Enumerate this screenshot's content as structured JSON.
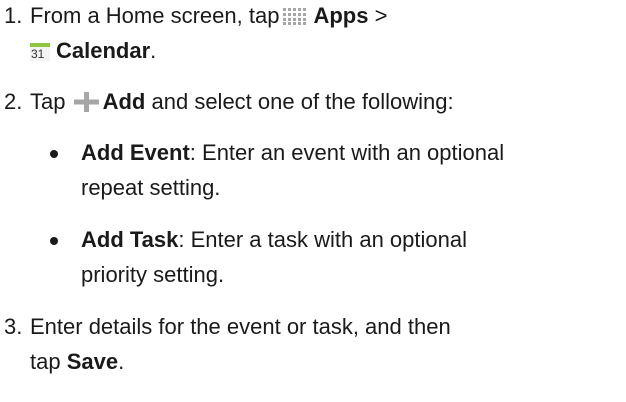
{
  "steps": [
    {
      "number": "1.",
      "line1_pre": "From a Home screen, tap",
      "line1_bold": "Apps",
      "line1_post": ">",
      "line2_bold": "Calendar",
      "line2_post": ".",
      "calendar_icon_text": "31"
    },
    {
      "number": "2.",
      "pre": "Tap",
      "bold": "Add",
      "post": "and select one of the following:",
      "options": [
        {
          "bold": "Add Event",
          "line1": ": Enter an event with an optional",
          "line2": "repeat setting."
        },
        {
          "bold": "Add Task",
          "line1": ": Enter a task with an optional",
          "line2": "priority setting."
        }
      ]
    },
    {
      "number": "3.",
      "line1": "Enter details for the event or task, and then",
      "line2_pre": "tap",
      "line2_bold": "Save",
      "line2_post": "."
    }
  ],
  "icons": {
    "apps": "apps-grid-icon",
    "calendar": "calendar-icon",
    "add": "plus-icon"
  },
  "colors": {
    "text": "#1a1a1a",
    "icon_grey": "#a6a6a6",
    "calendar_green": "#8dc63f"
  }
}
